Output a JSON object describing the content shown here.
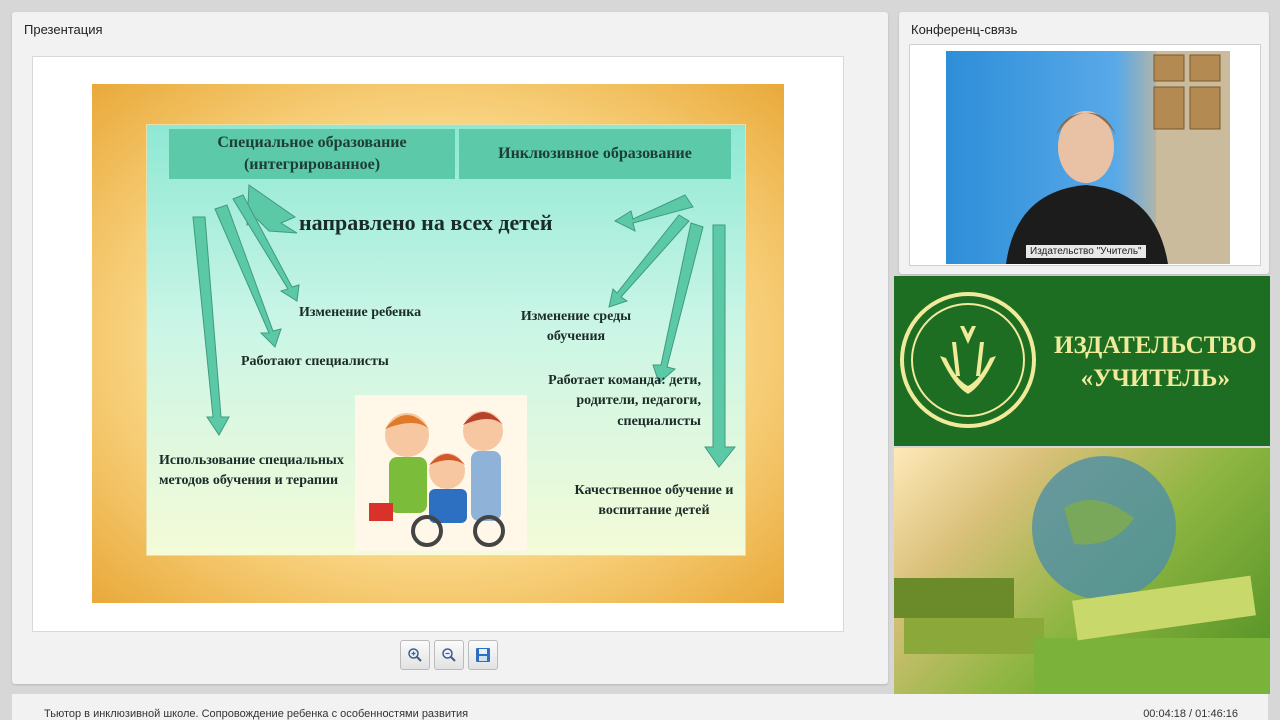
{
  "presentation": {
    "panel_title": "Презентация",
    "slide": {
      "col1_header": "Специальное образование (интегрированное)",
      "col2_header": "Инклюзивное образование",
      "main_phrase": "направлено на всех детей",
      "left_items": [
        "Изменение ребенка",
        "Работают специалисты",
        "Использование специальных методов обучения и терапии"
      ],
      "right_items": [
        "Изменение среды обучения",
        "Работает команда: дети, родители, педагоги, специалисты",
        "Качественное обучение и воспитание детей"
      ]
    },
    "toolbar": {
      "zoom_in_icon": "zoom-in-icon",
      "zoom_out_icon": "zoom-out-icon",
      "save_icon": "floppy-disk-icon"
    }
  },
  "conference": {
    "panel_title": "Конференц-связь",
    "video_label": "Издательство \"Учитель\""
  },
  "brand": {
    "line1": "ИЗДАТЕЛЬСТВО",
    "line2": "«УЧИТЕЛЬ»",
    "color_green": "#1d6e22",
    "color_text": "#f1ea9a"
  },
  "status": {
    "course_title": "Тьютор в инклюзивной школе. Сопровождение ребенка с особенностями развития",
    "timecode": "00:04:18 / 01:46:16"
  }
}
